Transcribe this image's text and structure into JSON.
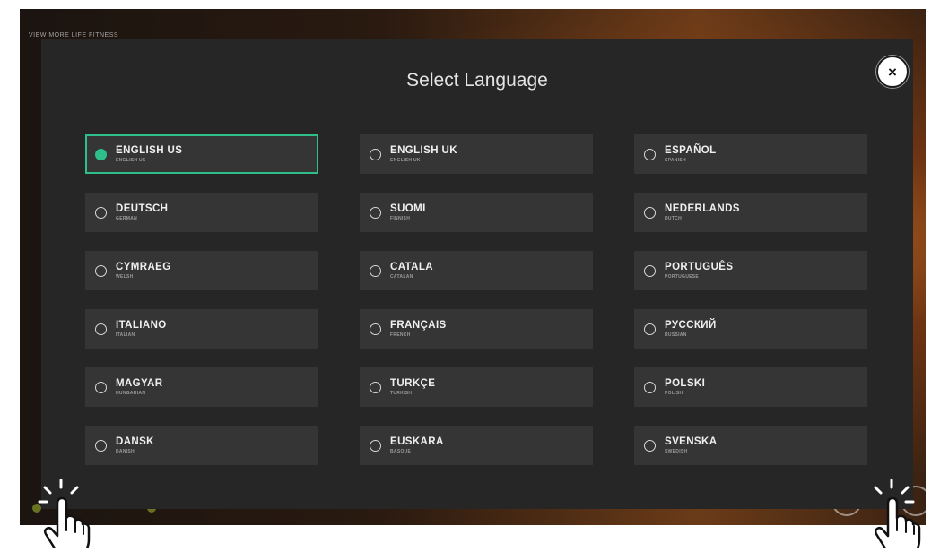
{
  "background": {
    "title": "VIEW MORE LIFE FITNESS",
    "left_label_1": "",
    "left_label_2": "",
    "accent_green": "#8a9a2a"
  },
  "modal": {
    "title": "Select Language",
    "close_label": "×",
    "selected_color": "#2fbf8b",
    "options": [
      {
        "native": "ENGLISH US",
        "english": "ENGLISH US",
        "selected": true
      },
      {
        "native": "ENGLISH UK",
        "english": "ENGLISH UK",
        "selected": false
      },
      {
        "native": "ESPAÑOL",
        "english": "SPANISH",
        "selected": false
      },
      {
        "native": "DEUTSCH",
        "english": "GERMAN",
        "selected": false
      },
      {
        "native": "SUOMI",
        "english": "FINNISH",
        "selected": false
      },
      {
        "native": "NEDERLANDS",
        "english": "DUTCH",
        "selected": false
      },
      {
        "native": "CYMRAEG",
        "english": "WELSH",
        "selected": false
      },
      {
        "native": "CATALA",
        "english": "CATALAN",
        "selected": false
      },
      {
        "native": "PORTUGUÊS",
        "english": "PORTUGUESE",
        "selected": false
      },
      {
        "native": "ITALIANO",
        "english": "ITALIAN",
        "selected": false
      },
      {
        "native": "FRANÇAIS",
        "english": "FRENCH",
        "selected": false
      },
      {
        "native": "РУССКИЙ",
        "english": "RUSSIAN",
        "selected": false
      },
      {
        "native": "MAGYAR",
        "english": "HUNGARIAN",
        "selected": false
      },
      {
        "native": "TURKÇE",
        "english": "TURKISH",
        "selected": false
      },
      {
        "native": "POLSKI",
        "english": "POLISH",
        "selected": false
      },
      {
        "native": "DANSK",
        "english": "DANISH",
        "selected": false
      },
      {
        "native": "EUSKARA",
        "english": "BASQUE",
        "selected": false
      },
      {
        "native": "SVENSKA",
        "english": "SWEDISH",
        "selected": false
      }
    ]
  },
  "icons": {
    "close": "close-icon",
    "tap_hint": "tap-gesture-icon"
  }
}
